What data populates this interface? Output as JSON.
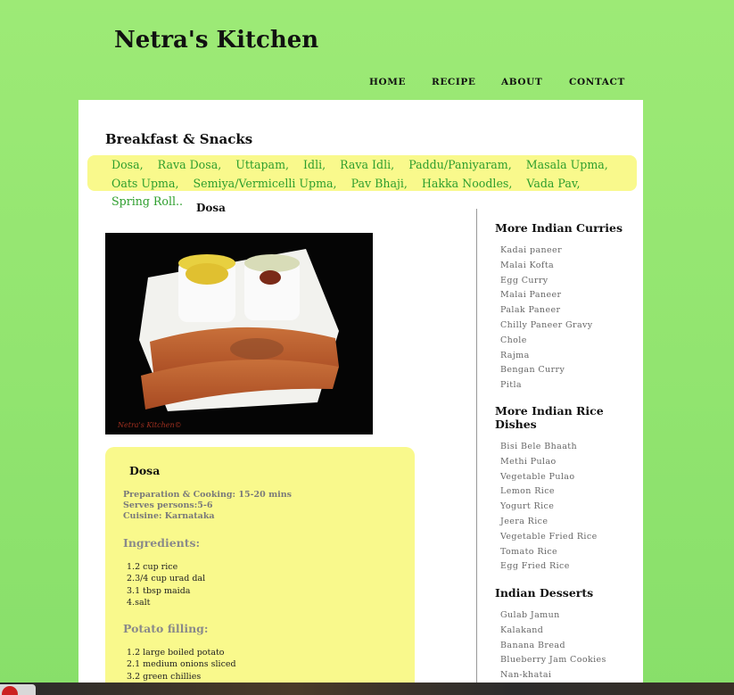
{
  "site": {
    "title": "Netra's Kitchen"
  },
  "nav": [
    {
      "label": "HOME"
    },
    {
      "label": "RECIPE"
    },
    {
      "label": "ABOUT"
    },
    {
      "label": "CONTACT"
    }
  ],
  "breakfast": {
    "heading": "Breakfast & Snacks",
    "recipes": [
      "Dosa,",
      "Rava Dosa,",
      "Uttapam,",
      "Idli,",
      "Rava Idli,",
      "Paddu/Paniyaram,",
      "Masala Upma,",
      "Oats Upma,",
      "Semiya/Vermicelli Upma,",
      "Pav Bhaji,",
      "Hakka Noodles,",
      "Vada Pav,",
      "Spring Roll"
    ],
    "more": ".."
  },
  "post": {
    "small_title": "Dosa",
    "photo_watermark": "Netra's Kitchen©",
    "card": {
      "title": "Dosa",
      "prep": "Preparation & Cooking: 15-20 mins",
      "serves": "Serves persons:5-6",
      "cuisine": "Cuisine: Karnataka",
      "ingredients_heading": "Ingredients:",
      "ingredients": [
        "1.2 cup rice",
        "2.3/4 cup urad dal",
        "3.1 tbsp maida",
        "4.salt"
      ],
      "filling_heading": "Potato filling:",
      "filling": [
        "1.2 large boiled potato",
        "2.1 medium onions sliced",
        "3.2 green chillies"
      ]
    }
  },
  "sidebar": {
    "curries": {
      "heading": "More Indian Curries",
      "items": [
        "Kadai paneer",
        "Malai Kofta",
        "Egg Curry",
        "Malai Paneer",
        "Palak Paneer",
        "Chilly Paneer Gravy",
        "Chole",
        "Rajma",
        "Bengan Curry",
        "Pitla"
      ]
    },
    "rice": {
      "heading": "More Indian Rice Dishes",
      "items": [
        "Bisi Bele Bhaath",
        "Methi Pulao",
        "Vegetable Pulao",
        "Lemon Rice",
        "Yogurt Rice",
        "Jeera Rice",
        "Vegetable Fried Rice",
        "Tomato Rice",
        "Egg Fried Rice"
      ]
    },
    "desserts": {
      "heading": "Indian Desserts",
      "items": [
        "Gulab Jamun",
        "Kalakand",
        "Banana Bread",
        "Blueberry Jam Cookies",
        "Nan-khatai"
      ]
    }
  },
  "colors": {
    "background": "#9dea76",
    "highlight": "#f9f98c",
    "link_green": "#2d9e2d"
  }
}
